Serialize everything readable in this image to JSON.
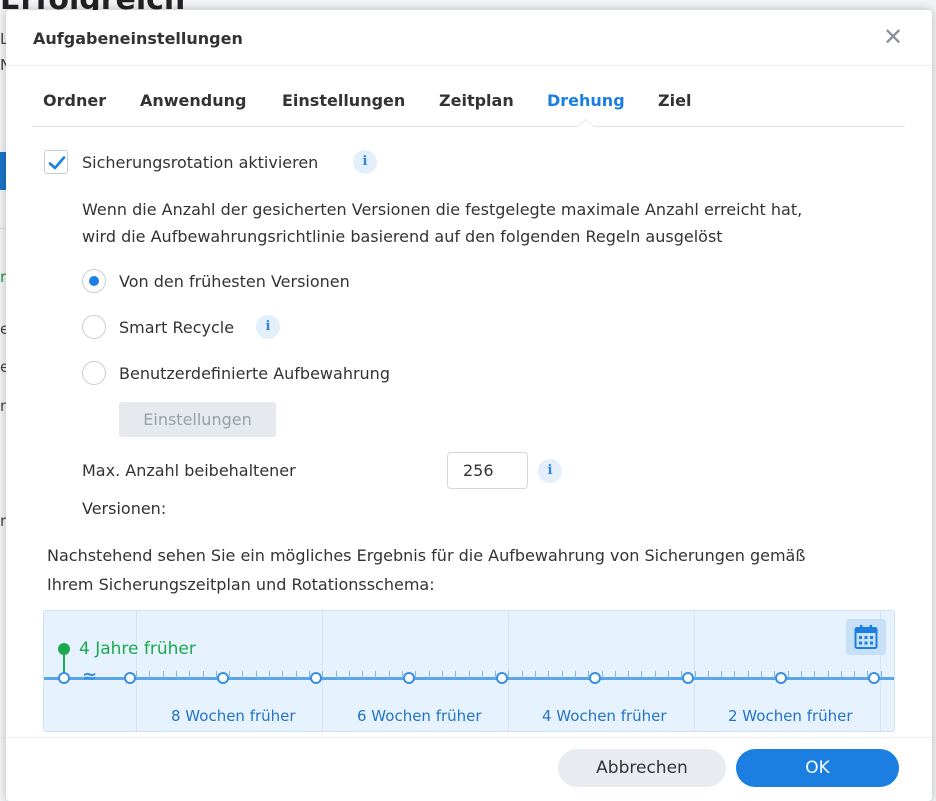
{
  "background": {
    "title": "Erfolgreich",
    "letters": [
      "L",
      "N",
      "e",
      "e",
      "n",
      "r"
    ],
    "status_glyph": "r"
  },
  "dialog": {
    "title": "Aufgabeneinstellungen",
    "close_glyph": "✕"
  },
  "tabs": [
    {
      "label": "Ordner",
      "active": false
    },
    {
      "label": "Anwendung",
      "active": false
    },
    {
      "label": "Einstellungen",
      "active": false
    },
    {
      "label": "Zeitplan",
      "active": false
    },
    {
      "label": "Drehung",
      "active": true
    },
    {
      "label": "Ziel",
      "active": false
    }
  ],
  "rotation": {
    "enable_label": "Sicherungsrotation aktivieren",
    "enabled": true,
    "description_line1": "Wenn die Anzahl der gesicherten Versionen die festgelegte maximale Anzahl erreicht hat,",
    "description_line2": "wird die Aufbewahrungsrichtlinie basierend auf den folgenden Regeln ausgelöst",
    "options": [
      {
        "label": "Von den frühesten Versionen",
        "selected": true
      },
      {
        "label": "Smart Recycle",
        "selected": false
      },
      {
        "label": "Benutzerdefinierte Aufbewahrung",
        "selected": false
      }
    ],
    "settings_button": "Einstellungen",
    "max_versions_label_line1": "Max. Anzahl beibehaltener",
    "max_versions_label_line2": "Versionen:",
    "max_versions_value": "256",
    "note_line1": "Nachstehend sehen Sie ein mögliches Ergebnis für die Aufbewahrung von Sicherungen gemäß",
    "note_line2": "Ihrem Sicherungszeitplan und Rotationsschema:"
  },
  "timeline": {
    "oldest_label": "4 Jahre früher",
    "week_labels": [
      "8 Wochen früher",
      "6 Wochen früher",
      "4 Wochen früher",
      "2 Wochen früher"
    ],
    "colors": {
      "accent": "#1a7fe0",
      "green": "#1ba84f",
      "background": "#e6f2fd"
    }
  },
  "footer": {
    "cancel_label": "Abbrechen",
    "ok_label": "OK"
  },
  "icons": {
    "info": "i",
    "calendar": "calendar-icon",
    "check": "checkmark-icon"
  }
}
